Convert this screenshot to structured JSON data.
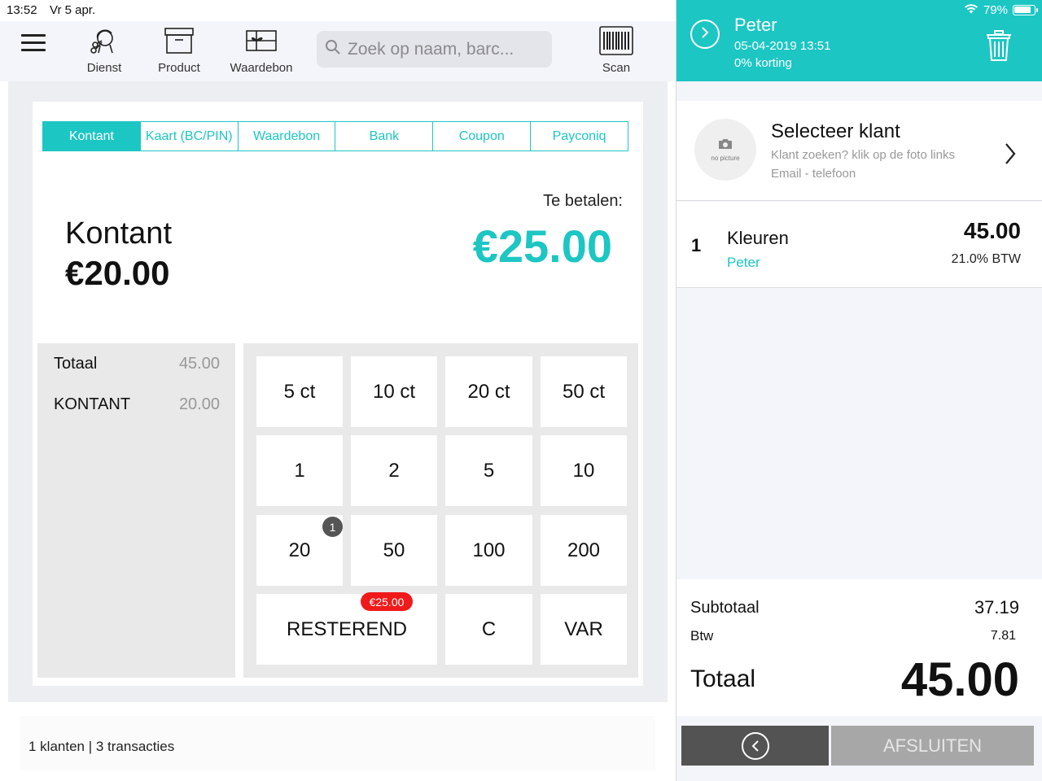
{
  "status_left": {
    "time": "13:52",
    "date": "Vr 5 apr."
  },
  "status_right": {
    "battery": "79%"
  },
  "toolbar": {
    "service_label": "Dienst",
    "product_label": "Product",
    "voucher_label": "Waardebon",
    "scan_label": "Scan",
    "search_placeholder": "Zoek op naam, barc..."
  },
  "payment_tabs": [
    "Kontant",
    "Kaart (BC/PIN)",
    "Waardebon",
    "Bank",
    "Coupon",
    "Payconiq"
  ],
  "active_tab": "Kontant",
  "payment": {
    "method": "Kontant",
    "amount": "€20.00",
    "due_label": "Te betalen:",
    "due_amount": "€25.00"
  },
  "summary": {
    "total_label": "Totaal",
    "total_value": "45.00",
    "cash_label": "KONTANT",
    "cash_value": "20.00"
  },
  "keypad": {
    "k5ct": "5 ct",
    "k10ct": "10 ct",
    "k20ct": "20 ct",
    "k50ct": "50 ct",
    "k1": "1",
    "k2": "2",
    "k5": "5",
    "k10": "10",
    "k20": "20",
    "k50": "50",
    "k100": "100",
    "k200": "200",
    "rest": "RESTEREND",
    "clear": "C",
    "var": "VAR",
    "count_20": "1",
    "rest_badge": "€25.00"
  },
  "footer": {
    "text": "1 klanten | 3 transacties"
  },
  "customer": {
    "name": "Peter",
    "datetime": "05-04-2019 13:51",
    "discount": "0% korting"
  },
  "client_select": {
    "title": "Selecteer klant",
    "hint": "Klant zoeken? klik op de foto links",
    "contact": "Email - telefoon",
    "no_picture": "no picture"
  },
  "line_item": {
    "qty": "1",
    "name": "Kleuren",
    "staff": "Peter",
    "price": "45.00",
    "vat": "21.0% BTW"
  },
  "totals": {
    "subtotal_label": "Subtotaal",
    "subtotal_value": "37.19",
    "vat_label": "Btw",
    "vat_value": "7.81",
    "total_label": "Totaal",
    "total_value": "45.00"
  },
  "actions": {
    "close_label": "AFSLUITEN"
  },
  "colors": {
    "accent": "#1cc6c3",
    "badge_red": "#f01a1a",
    "dark_button": "#535353",
    "disabled_button": "#a7a7a7"
  }
}
